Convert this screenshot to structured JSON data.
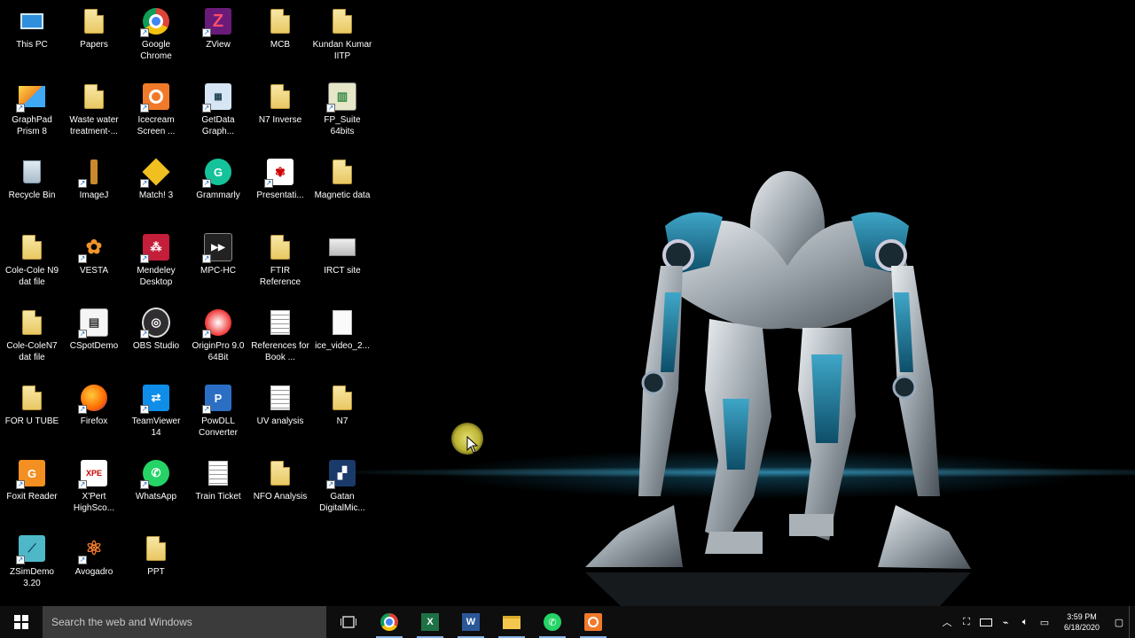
{
  "desktop": {
    "icons": [
      {
        "label": "This PC",
        "icon": "this-pc-icon"
      },
      {
        "label": "Papers",
        "icon": "folder-icon"
      },
      {
        "label": "Google Chrome",
        "icon": "chrome-icon"
      },
      {
        "label": "ZView",
        "icon": "zview-icon"
      },
      {
        "label": "MCB",
        "icon": "folder-icon"
      },
      {
        "label": "Kundan Kumar IITP",
        "icon": "folder-icon"
      },
      {
        "label": "GraphPad Prism 8",
        "icon": "graphpad-icon"
      },
      {
        "label": "Waste water treatment-...",
        "icon": "folder-icon"
      },
      {
        "label": "Icecream Screen ...",
        "icon": "icecream-icon"
      },
      {
        "label": "GetData Graph...",
        "icon": "getdata-icon"
      },
      {
        "label": "N7 Inverse",
        "icon": "folder-icon"
      },
      {
        "label": "FP_Suite 64bits",
        "icon": "fpsuite-icon"
      },
      {
        "label": "Recycle Bin",
        "icon": "recycle-bin-icon"
      },
      {
        "label": "ImageJ",
        "icon": "imagej-icon"
      },
      {
        "label": "Match! 3",
        "icon": "match-icon"
      },
      {
        "label": "Grammarly",
        "icon": "grammarly-icon"
      },
      {
        "label": "Presentati...",
        "icon": "presentation-icon"
      },
      {
        "label": "Magnetic data",
        "icon": "folder-icon"
      },
      {
        "label": "Cole-Cole N9 dat file",
        "icon": "folder-icon"
      },
      {
        "label": "VESTA",
        "icon": "vesta-icon"
      },
      {
        "label": "Mendeley Desktop",
        "icon": "mendeley-icon"
      },
      {
        "label": "MPC-HC",
        "icon": "mpc-hc-icon"
      },
      {
        "label": "FTIR Reference",
        "icon": "folder-icon"
      },
      {
        "label": "IRCT site",
        "icon": "irct-icon"
      },
      {
        "label": "Cole-ColeN7 dat file",
        "icon": "folder-icon"
      },
      {
        "label": "CSpotDemo",
        "icon": "cspot-icon"
      },
      {
        "label": "OBS Studio",
        "icon": "obs-icon"
      },
      {
        "label": "OriginPro 9.0 64Bit",
        "icon": "origin-icon"
      },
      {
        "label": "References for Book ...",
        "icon": "document-icon"
      },
      {
        "label": "ice_video_2...",
        "icon": "file-icon"
      },
      {
        "label": "FOR U TUBE",
        "icon": "folder-icon"
      },
      {
        "label": "Firefox",
        "icon": "firefox-icon"
      },
      {
        "label": "TeamViewer 14",
        "icon": "teamviewer-icon"
      },
      {
        "label": "PowDLL Converter",
        "icon": "powdll-icon"
      },
      {
        "label": "UV analysis",
        "icon": "document-icon"
      },
      {
        "label": "N7",
        "icon": "folder-icon"
      },
      {
        "label": "Foxit Reader",
        "icon": "foxit-icon"
      },
      {
        "label": "X'Pert HighSco...",
        "icon": "xpert-icon"
      },
      {
        "label": "WhatsApp",
        "icon": "whatsapp-icon"
      },
      {
        "label": "Train Ticket",
        "icon": "document-icon"
      },
      {
        "label": "NFO Analysis",
        "icon": "folder-icon"
      },
      {
        "label": "Gatan DigitalMic...",
        "icon": "gatan-icon"
      },
      {
        "label": "ZSimDemo 3.20",
        "icon": "zsim-icon"
      },
      {
        "label": "Avogadro",
        "icon": "avogadro-icon"
      },
      {
        "label": "PPT",
        "icon": "folder-icon"
      }
    ]
  },
  "taskbar": {
    "search_placeholder": "Search the web and Windows",
    "pinned": [
      {
        "name": "task-view-icon"
      },
      {
        "name": "chrome-icon"
      },
      {
        "name": "excel-icon"
      },
      {
        "name": "word-icon"
      },
      {
        "name": "file-explorer-icon"
      },
      {
        "name": "whatsapp-icon"
      },
      {
        "name": "icecream-icon"
      }
    ],
    "clock": {
      "time": "3:59 PM",
      "date": "6/18/2020"
    }
  }
}
